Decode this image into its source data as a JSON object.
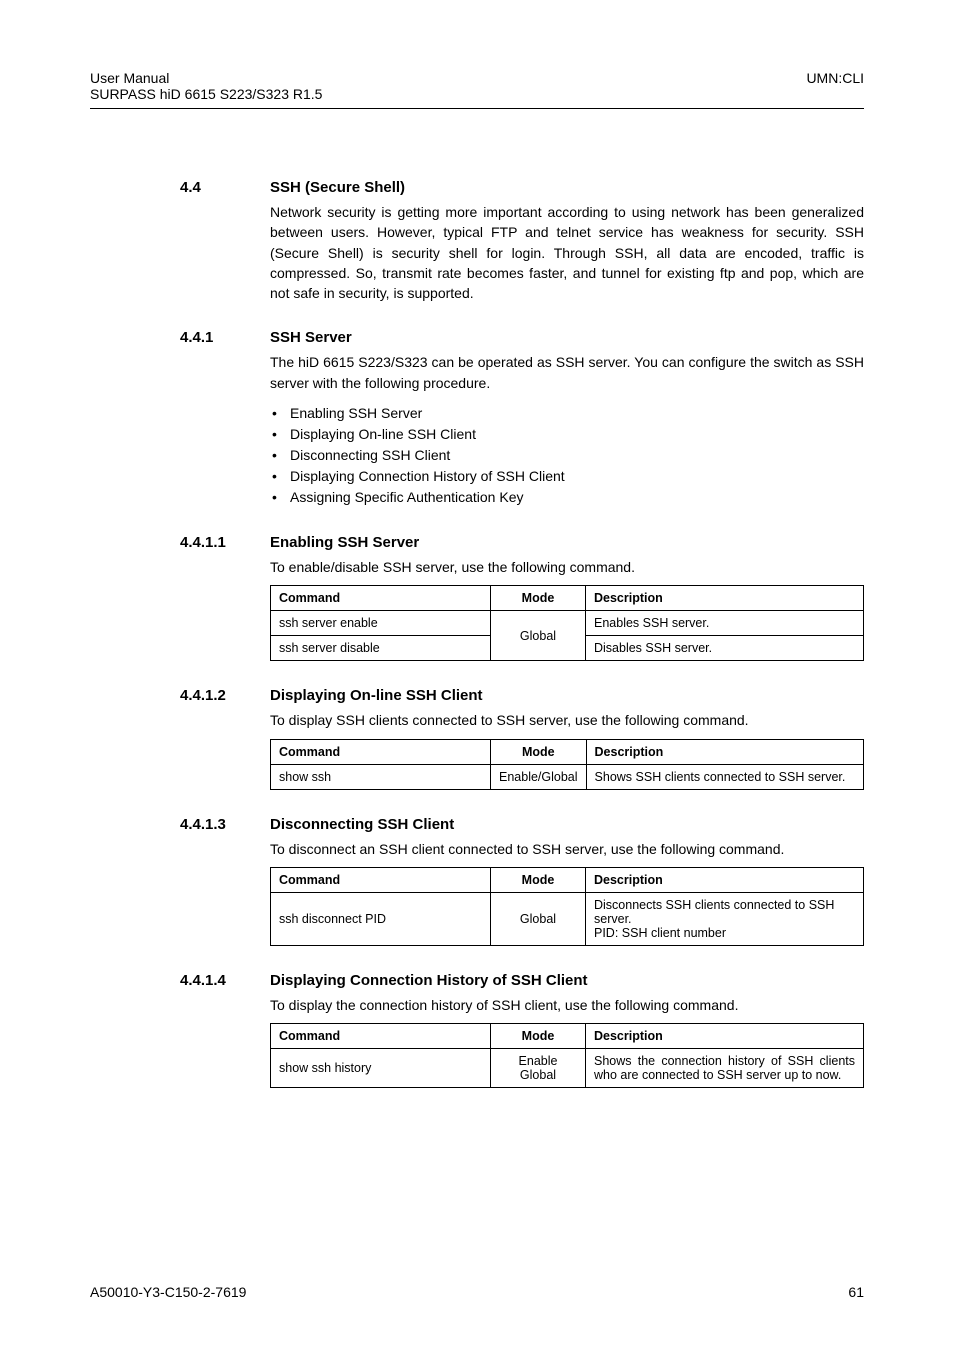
{
  "header": {
    "left_line1": "User  Manual",
    "left_line2": "SURPASS hiD 6615 S223/S323 R1.5",
    "right": "UMN:CLI"
  },
  "s1": {
    "num": "4.4",
    "title": "SSH (Secure Shell)",
    "para": "Network security is getting more important according to using network has been generalized between users. However, typical FTP and telnet service has weakness for security. SSH (Secure Shell) is security shell for login. Through SSH, all data are encoded, traffic is compressed. So, transmit rate becomes faster, and tunnel for existing ftp and pop, which are not safe in security, is supported."
  },
  "s2": {
    "num": "4.4.1",
    "title": "SSH Server",
    "para": "The hiD 6615 S223/S323 can be operated as SSH server. You can configure the switch as SSH server with the following procedure.",
    "bullets": [
      "Enabling SSH Server",
      "Displaying On-line SSH Client",
      "Disconnecting SSH Client",
      "Displaying Connection History of SSH Client",
      "Assigning Specific Authentication Key"
    ]
  },
  "s3": {
    "num": "4.4.1.1",
    "title": "Enabling SSH Server",
    "para": "To enable/disable SSH server, use the following command.",
    "th_cmd": "Command",
    "th_mode": "Mode",
    "th_desc": "Description",
    "r1_cmd": "ssh server enable",
    "mode": "Global",
    "r1_desc": "Enables SSH server.",
    "r2_cmd": "ssh server disable",
    "r2_desc": "Disables SSH server."
  },
  "s4": {
    "num": "4.4.1.2",
    "title": "Displaying On-line SSH Client",
    "para": "To display SSH clients connected to SSH server, use the following command.",
    "th_cmd": "Command",
    "th_mode": "Mode",
    "th_desc": "Description",
    "r1_cmd": "show ssh",
    "r1_mode": "Enable/Global",
    "r1_desc": "Shows SSH clients connected to SSH server."
  },
  "s5": {
    "num": "4.4.1.3",
    "title": "Disconnecting SSH Client",
    "para": "To disconnect an SSH client connected to SSH server, use the following command.",
    "th_cmd": "Command",
    "th_mode": "Mode",
    "th_desc": "Description",
    "r1_cmd": "ssh disconnect PID",
    "r1_mode": "Global",
    "r1_desc_l1": "Disconnects SSH clients connected to SSH server.",
    "r1_desc_l2": "PID: SSH client number"
  },
  "s6": {
    "num": "4.4.1.4",
    "title": "Displaying Connection History of SSH Client",
    "para": "To display the connection history of SSH client, use the following command.",
    "th_cmd": "Command",
    "th_mode": "Mode",
    "th_desc": "Description",
    "r1_cmd": "show ssh history",
    "r1_mode_l1": "Enable",
    "r1_mode_l2": "Global",
    "r1_desc": "Shows the connection history of SSH clients who are connected to SSH server up to now."
  },
  "footer": {
    "left": "A50010-Y3-C150-2-7619",
    "right": "61"
  }
}
